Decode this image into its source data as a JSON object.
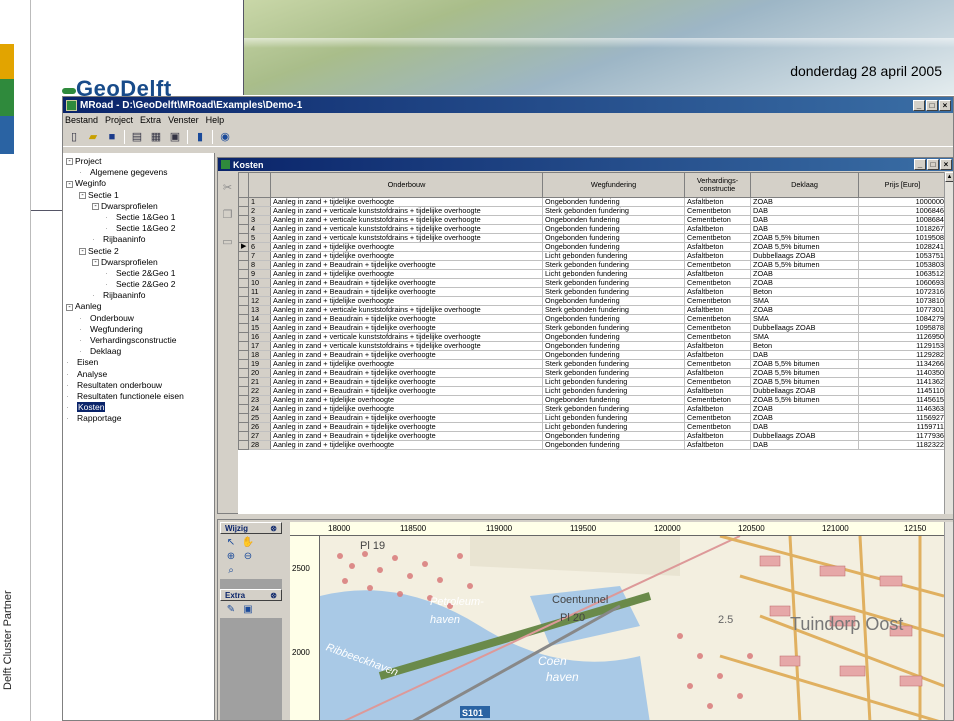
{
  "slide": {
    "date": "donderdag 28 april 2005",
    "logo": "GeoDelft",
    "partner_label": "Delft Cluster Partner"
  },
  "window": {
    "title": "MRoad - D:\\GeoDelft\\MRoad\\Examples\\Demo-1",
    "menu": [
      "Bestand",
      "Project",
      "Extra",
      "Venster",
      "Help"
    ]
  },
  "tree": [
    {
      "label": "Project",
      "depth": 0,
      "exp": "-"
    },
    {
      "label": "Algemene gegevens",
      "depth": 1,
      "exp": ""
    },
    {
      "label": "Weginfo",
      "depth": 0,
      "exp": "-"
    },
    {
      "label": "Sectie 1",
      "depth": 1,
      "exp": "-"
    },
    {
      "label": "Dwarsprofielen",
      "depth": 2,
      "exp": "-"
    },
    {
      "label": "Sectie 1&Geo 1",
      "depth": 3,
      "exp": ""
    },
    {
      "label": "Sectie 1&Geo 2",
      "depth": 3,
      "exp": ""
    },
    {
      "label": "Rijbaaninfo",
      "depth": 2,
      "exp": ""
    },
    {
      "label": "Sectie 2",
      "depth": 1,
      "exp": "-"
    },
    {
      "label": "Dwarsprofielen",
      "depth": 2,
      "exp": "-"
    },
    {
      "label": "Sectie 2&Geo 1",
      "depth": 3,
      "exp": ""
    },
    {
      "label": "Sectie 2&Geo 2",
      "depth": 3,
      "exp": ""
    },
    {
      "label": "Rijbaaninfo",
      "depth": 2,
      "exp": ""
    },
    {
      "label": "Aanleg",
      "depth": 0,
      "exp": "-"
    },
    {
      "label": "Onderbouw",
      "depth": 1,
      "exp": ""
    },
    {
      "label": "Wegfundering",
      "depth": 1,
      "exp": ""
    },
    {
      "label": "Verhardingsconstructie",
      "depth": 1,
      "exp": ""
    },
    {
      "label": "Deklaag",
      "depth": 1,
      "exp": ""
    },
    {
      "label": "Eisen",
      "depth": 0,
      "exp": ""
    },
    {
      "label": "Analyse",
      "depth": 0,
      "exp": ""
    },
    {
      "label": "Resultaten onderbouw",
      "depth": 0,
      "exp": ""
    },
    {
      "label": "Resultaten functionele eisen",
      "depth": 0,
      "exp": ""
    },
    {
      "label": "Kosten",
      "depth": 0,
      "exp": "",
      "selected": true
    },
    {
      "label": "Rapportage",
      "depth": 0,
      "exp": ""
    }
  ],
  "kosten": {
    "title": "Kosten",
    "columns": [
      "Onderbouw",
      "Wegfundering",
      "Verhardings-constructie",
      "Deklaag",
      "Prijs [Euro]"
    ],
    "current_row": 6,
    "rows": [
      [
        "1",
        "Aanleg in zand + tijdelijke overhoogte",
        "Ongebonden fundering",
        "Asfaltbeton",
        "ZOAB",
        "1000000"
      ],
      [
        "2",
        "Aanleg in zand + verticale kunststofdrains + tijdelijke overhoogte",
        "Sterk gebonden fundering",
        "Cementbeton",
        "DAB",
        "1006846"
      ],
      [
        "3",
        "Aanleg in zand + verticale kunststofdrains + tijdelijke overhoogte",
        "Ongebonden fundering",
        "Cementbeton",
        "DAB",
        "1008684"
      ],
      [
        "4",
        "Aanleg in zand + verticale kunststofdrains + tijdelijke overhoogte",
        "Ongebonden fundering",
        "Asfaltbeton",
        "DAB",
        "1018267"
      ],
      [
        "5",
        "Aanleg in zand + verticale kunststofdrains + tijdelijke overhoogte",
        "Ongebonden fundering",
        "Cementbeton",
        "ZOAB 5,5% bitumen",
        "1019508"
      ],
      [
        "6",
        "Aanleg in zand + tijdelijke overhoogte",
        "Ongebonden fundering",
        "Asfaltbeton",
        "ZOAB 5,5% bitumen",
        "1028241"
      ],
      [
        "7",
        "Aanleg in zand + tijdelijke overhoogte",
        "Licht gebonden fundering",
        "Asfaltbeton",
        "Dubbellaags ZOAB",
        "1053751"
      ],
      [
        "8",
        "Aanleg in zand + Beaudrain + tijdelijke overhoogte",
        "Sterk gebonden fundering",
        "Cementbeton",
        "ZOAB 5,5% bitumen",
        "1053803"
      ],
      [
        "9",
        "Aanleg in zand + tijdelijke overhoogte",
        "Licht gebonden fundering",
        "Asfaltbeton",
        "ZOAB",
        "1063512"
      ],
      [
        "10",
        "Aanleg in zand + Beaudrain + tijdelijke overhoogte",
        "Sterk gebonden fundering",
        "Cementbeton",
        "ZOAB",
        "1060693"
      ],
      [
        "11",
        "Aanleg in zand + Beaudrain + tijdelijke overhoogte",
        "Sterk gebonden fundering",
        "Asfaltbeton",
        "Beton",
        "1072316"
      ],
      [
        "12",
        "Aanleg in zand + tijdelijke overhoogte",
        "Ongebonden fundering",
        "Cementbeton",
        "SMA",
        "1073810"
      ],
      [
        "13",
        "Aanleg in zand + verticale kunststofdrains + tijdelijke overhoogte",
        "Sterk gebonden fundering",
        "Asfaltbeton",
        "ZOAB",
        "1077301"
      ],
      [
        "14",
        "Aanleg in zand + Beaudrain + tijdelijke overhoogte",
        "Ongebonden fundering",
        "Cementbeton",
        "SMA",
        "1084279"
      ],
      [
        "15",
        "Aanleg in zand + Beaudrain + tijdelijke overhoogte",
        "Sterk gebonden fundering",
        "Cementbeton",
        "Dubbellaags ZOAB",
        "1095878"
      ],
      [
        "16",
        "Aanleg in zand + verticale kunststofdrains + tijdelijke overhoogte",
        "Ongebonden fundering",
        "Cementbeton",
        "SMA",
        "1126950"
      ],
      [
        "17",
        "Aanleg in zand + verticale kunststofdrains + tijdelijke overhoogte",
        "Ongebonden fundering",
        "Asfaltbeton",
        "Beton",
        "1129153"
      ],
      [
        "18",
        "Aanleg in zand + Beaudrain + tijdelijke overhoogte",
        "Ongebonden fundering",
        "Asfaltbeton",
        "DAB",
        "1129282"
      ],
      [
        "19",
        "Aanleg in zand + tijdelijke overhoogte",
        "Sterk gebonden fundering",
        "Cementbeton",
        "ZOAB 5,5% bitumen",
        "1134266"
      ],
      [
        "20",
        "Aanleg in zand + Beaudrain + tijdelijke overhoogte",
        "Sterk gebonden fundering",
        "Asfaltbeton",
        "ZOAB 5,5% bitumen",
        "1140350"
      ],
      [
        "21",
        "Aanleg in zand + Beaudrain + tijdelijke overhoogte",
        "Licht gebonden fundering",
        "Cementbeton",
        "ZOAB 5,5% bitumen",
        "1141362"
      ],
      [
        "22",
        "Aanleg in zand + Beaudrain + tijdelijke overhoogte",
        "Licht gebonden fundering",
        "Asfaltbeton",
        "Dubbellaags ZOAB",
        "1145110"
      ],
      [
        "23",
        "Aanleg in zand + tijdelijke overhoogte",
        "Ongebonden fundering",
        "Cementbeton",
        "ZOAB 5,5% bitumen",
        "1145615"
      ],
      [
        "24",
        "Aanleg in zand + tijdelijke overhoogte",
        "Sterk gebonden fundering",
        "Asfaltbeton",
        "ZOAB",
        "1146363"
      ],
      [
        "25",
        "Aanleg in zand + Beaudrain + tijdelijke overhoogte",
        "Licht gebonden fundering",
        "Cementbeton",
        "ZOAB",
        "1156927"
      ],
      [
        "26",
        "Aanleg in zand + Beaudrain + tijdelijke overhoogte",
        "Licht gebonden fundering",
        "Cementbeton",
        "DAB",
        "1159711"
      ],
      [
        "27",
        "Aanleg in zand + Beaudrain + tijdelijke overhoogte",
        "Ongebonden fundering",
        "Asfaltbeton",
        "Dubbellaags ZOAB",
        "1177936"
      ],
      [
        "28",
        "Aanleg in zand + tijdelijke overhoogte",
        "Ongebonden fundering",
        "Asfaltbeton",
        "DAB",
        "1182322"
      ]
    ]
  },
  "map": {
    "tool_groups": [
      {
        "label": "Wijzig"
      },
      {
        "label": "Extra"
      }
    ],
    "ruler_x": [
      "18000",
      "118500",
      "119000",
      "119500",
      "120000",
      "120500",
      "121000",
      "12150"
    ],
    "ruler_y": [
      "2500",
      "2000"
    ],
    "labels": [
      "Pl 19",
      "Petroleum-",
      "haven",
      "Coentunnel",
      "Pl 20",
      "Coen",
      "haven",
      "2.5",
      "Tuindorp Oost",
      "S101",
      "Ribbeeckhaven"
    ]
  }
}
